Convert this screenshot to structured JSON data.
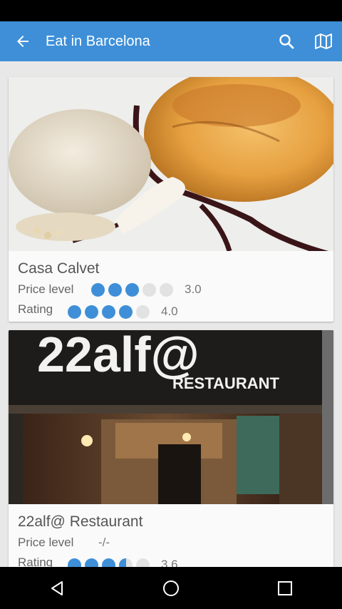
{
  "app_bar": {
    "title": "Eat in Barcelona",
    "back_icon": "arrow-left-icon",
    "search_icon": "search-icon",
    "map_icon": "map-icon",
    "color": "#3e8fd8"
  },
  "restaurants": [
    {
      "name": "Casa Calvet",
      "price_label": "Price level",
      "price_value": "3.0",
      "price_level": 3,
      "rating_label": "Rating",
      "rating_value": "4.0",
      "rating": 4
    },
    {
      "name": "22alf@ Restaurant",
      "price_label": "Price level",
      "price_value": "-/-",
      "rating_label": "Rating",
      "rating_value": "3.6",
      "rating": 3.6,
      "photo_sign_text": "RESTAURANT",
      "photo_logo_text": "22alf@"
    }
  ],
  "nav_bar": {
    "back_icon": "nav-back-icon",
    "home_icon": "nav-home-icon",
    "recents_icon": "nav-recents-icon"
  }
}
